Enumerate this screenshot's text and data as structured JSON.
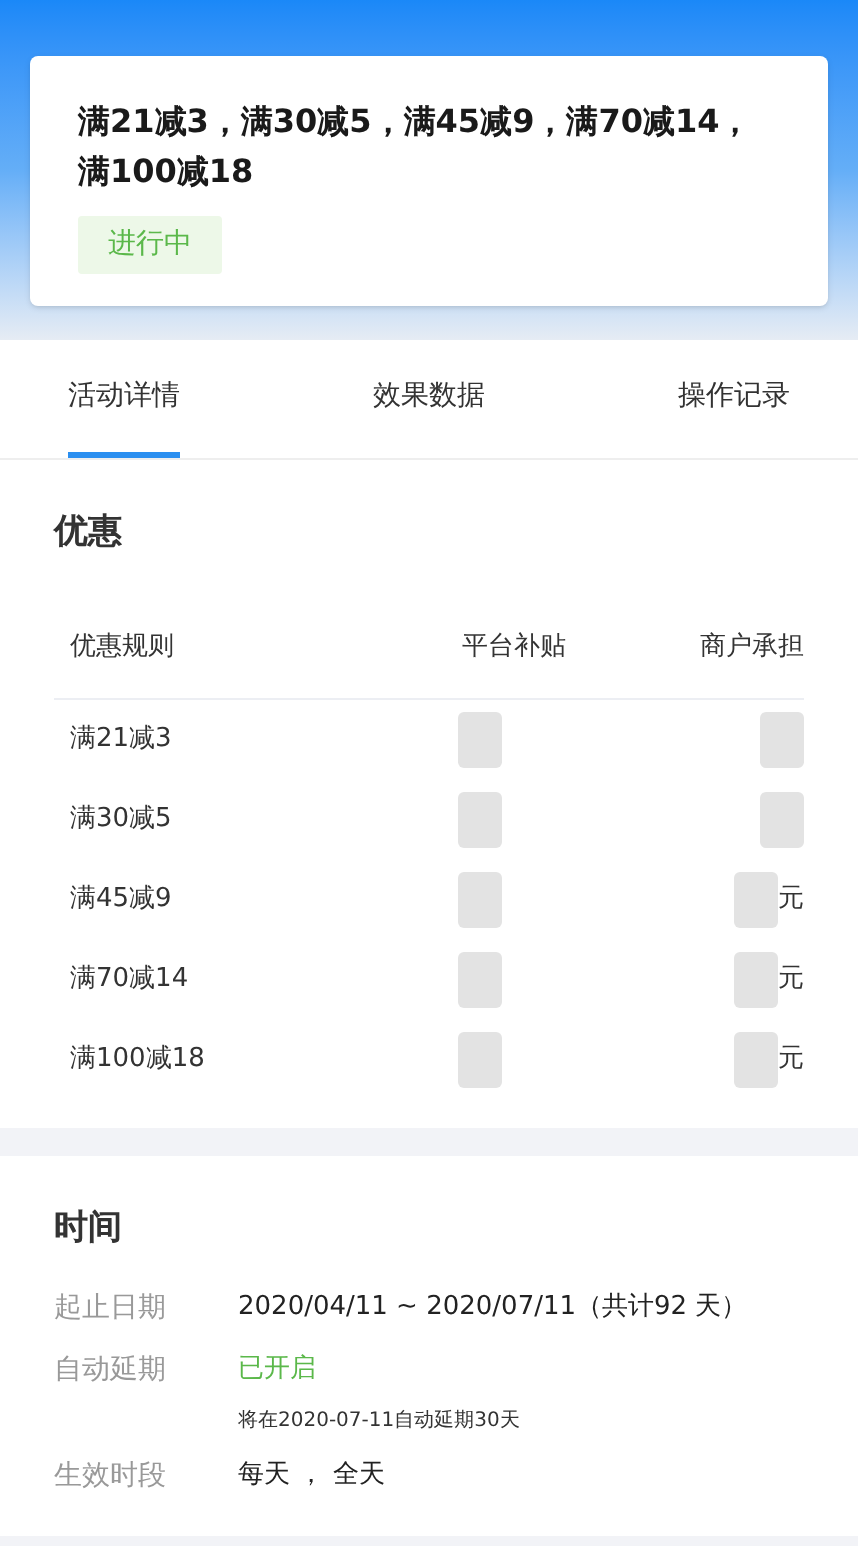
{
  "header_card": {
    "title": "满21减3，满30减5，满45减9，满70减14，满100减18",
    "status": "进行中"
  },
  "tabs": [
    {
      "label": "活动详情",
      "selected": true
    },
    {
      "label": "效果数据",
      "selected": false
    },
    {
      "label": "操作记录",
      "selected": false
    }
  ],
  "discount": {
    "heading": "优惠",
    "columns": [
      "优惠规则",
      "平台补贴",
      "商户承担"
    ],
    "rows": [
      {
        "rule": "满21减3"
      },
      {
        "rule": "满30减5"
      },
      {
        "rule": "满45减9",
        "merchant_suffix": "元"
      },
      {
        "rule": "满70减14",
        "merchant_suffix": "元"
      },
      {
        "rule": "满100减18",
        "merchant_suffix": "元"
      }
    ]
  },
  "time": {
    "heading": "时间",
    "rows": [
      {
        "label": "起止日期",
        "value": "2020/04/11 ~ 2020/07/11（共计92 天）",
        "kind": "plain"
      },
      {
        "label": "自动延期",
        "value": "已开启",
        "kind": "status",
        "note": "将在2020-07-11自动延期30天"
      },
      {
        "label": "生效时段",
        "value": "每天 ， 全天",
        "kind": "plain"
      }
    ]
  }
}
